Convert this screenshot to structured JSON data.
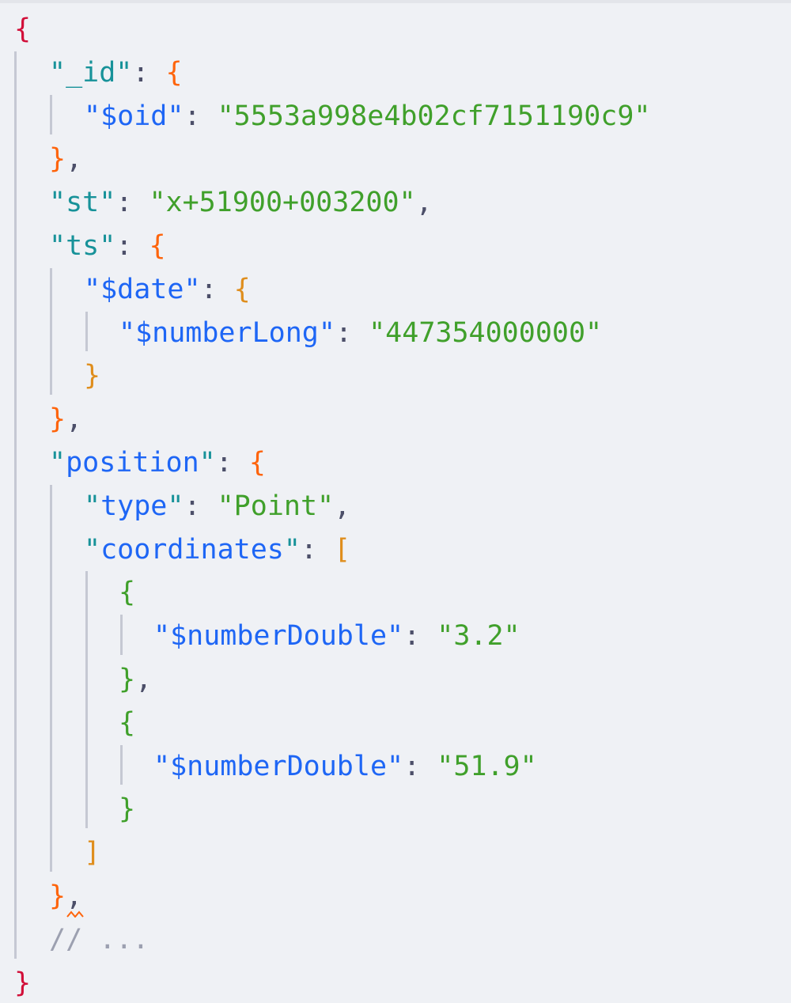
{
  "lines": [
    {
      "tokens": [
        {
          "t": "{",
          "c": "red"
        }
      ]
    },
    {
      "indent": 1,
      "tokens": [
        {
          "t": "\"",
          "c": "teal"
        },
        {
          "t": "_id",
          "c": "teal"
        },
        {
          "t": "\"",
          "c": "teal"
        },
        {
          "t": ": ",
          "c": "punct"
        },
        {
          "t": "{",
          "c": "orange"
        }
      ]
    },
    {
      "indent": 2,
      "tokens": [
        {
          "t": "\"",
          "c": "blue"
        },
        {
          "t": "$oid",
          "c": "blue"
        },
        {
          "t": "\"",
          "c": "blue"
        },
        {
          "t": ": ",
          "c": "punct"
        },
        {
          "t": "\"5553a998e4b02cf7151190c9\"",
          "c": "green"
        }
      ]
    },
    {
      "indent": 1,
      "tokens": [
        {
          "t": "}",
          "c": "orange"
        },
        {
          "t": ",",
          "c": "punct"
        }
      ]
    },
    {
      "indent": 1,
      "tokens": [
        {
          "t": "\"",
          "c": "teal"
        },
        {
          "t": "st",
          "c": "teal"
        },
        {
          "t": "\"",
          "c": "teal"
        },
        {
          "t": ": ",
          "c": "punct"
        },
        {
          "t": "\"x+51900+003200\"",
          "c": "green"
        },
        {
          "t": ",",
          "c": "punct"
        }
      ]
    },
    {
      "indent": 1,
      "tokens": [
        {
          "t": "\"",
          "c": "teal"
        },
        {
          "t": "ts",
          "c": "teal"
        },
        {
          "t": "\"",
          "c": "teal"
        },
        {
          "t": ": ",
          "c": "punct"
        },
        {
          "t": "{",
          "c": "orange"
        }
      ]
    },
    {
      "indent": 2,
      "tokens": [
        {
          "t": "\"",
          "c": "blue"
        },
        {
          "t": "$date",
          "c": "blue"
        },
        {
          "t": "\"",
          "c": "blue"
        },
        {
          "t": ": ",
          "c": "punct"
        },
        {
          "t": "{",
          "c": "gold"
        }
      ]
    },
    {
      "indent": 3,
      "tokens": [
        {
          "t": "\"",
          "c": "blue"
        },
        {
          "t": "$numberLong",
          "c": "blue"
        },
        {
          "t": "\"",
          "c": "blue"
        },
        {
          "t": ": ",
          "c": "punct"
        },
        {
          "t": "\"447354000000\"",
          "c": "green"
        }
      ]
    },
    {
      "indent": 2,
      "tokens": [
        {
          "t": "}",
          "c": "gold"
        }
      ]
    },
    {
      "indent": 1,
      "tokens": [
        {
          "t": "}",
          "c": "orange"
        },
        {
          "t": ",",
          "c": "punct"
        }
      ]
    },
    {
      "indent": 1,
      "tokens": [
        {
          "t": "\"",
          "c": "teal"
        },
        {
          "t": "position",
          "c": "blue"
        },
        {
          "t": "\"",
          "c": "teal"
        },
        {
          "t": ": ",
          "c": "punct"
        },
        {
          "t": "{",
          "c": "orange"
        }
      ]
    },
    {
      "indent": 2,
      "tokens": [
        {
          "t": "\"",
          "c": "teal"
        },
        {
          "t": "type",
          "c": "blue"
        },
        {
          "t": "\"",
          "c": "teal"
        },
        {
          "t": ": ",
          "c": "punct"
        },
        {
          "t": "\"Point\"",
          "c": "green"
        },
        {
          "t": ",",
          "c": "punct"
        }
      ]
    },
    {
      "indent": 2,
      "tokens": [
        {
          "t": "\"",
          "c": "teal"
        },
        {
          "t": "coordinates",
          "c": "blue"
        },
        {
          "t": "\"",
          "c": "teal"
        },
        {
          "t": ": ",
          "c": "punct"
        },
        {
          "t": "[",
          "c": "gold"
        }
      ]
    },
    {
      "indent": 3,
      "tokens": [
        {
          "t": "{",
          "c": "green"
        }
      ]
    },
    {
      "indent": 4,
      "tokens": [
        {
          "t": "\"",
          "c": "blue"
        },
        {
          "t": "$numberDouble",
          "c": "blue"
        },
        {
          "t": "\"",
          "c": "blue"
        },
        {
          "t": ": ",
          "c": "punct"
        },
        {
          "t": "\"3.2\"",
          "c": "green"
        }
      ]
    },
    {
      "indent": 3,
      "tokens": [
        {
          "t": "}",
          "c": "green"
        },
        {
          "t": ",",
          "c": "punct"
        }
      ]
    },
    {
      "indent": 3,
      "tokens": [
        {
          "t": "{",
          "c": "green"
        }
      ]
    },
    {
      "indent": 4,
      "tokens": [
        {
          "t": "\"",
          "c": "blue"
        },
        {
          "t": "$numberDouble",
          "c": "blue"
        },
        {
          "t": "\"",
          "c": "blue"
        },
        {
          "t": ": ",
          "c": "punct"
        },
        {
          "t": "\"51.9\"",
          "c": "green"
        }
      ]
    },
    {
      "indent": 3,
      "tokens": [
        {
          "t": "}",
          "c": "green"
        }
      ]
    },
    {
      "indent": 2,
      "tokens": [
        {
          "t": "]",
          "c": "gold"
        }
      ]
    },
    {
      "indent": 1,
      "tokens": [
        {
          "t": "}",
          "c": "orange"
        },
        {
          "t": ",",
          "c": "punct"
        }
      ],
      "squiggle": true
    },
    {
      "indent": 1,
      "tokens": [
        {
          "t": "// ...",
          "c": "comment"
        }
      ]
    },
    {
      "tokens": [
        {
          "t": "}",
          "c": "red"
        }
      ]
    }
  ],
  "colors": {
    "background": "#eff1f5",
    "brace_root": "#d20f39",
    "brace_level1": "#fe640b",
    "brace_level2": "#df8e1d",
    "brace_level3": "#40a02b",
    "key": "#1e66f5",
    "string": "#40a02b",
    "comment": "#9ca0b0",
    "indent_guide": "#c5c8d3",
    "warning_squiggle": "#fe640b"
  }
}
